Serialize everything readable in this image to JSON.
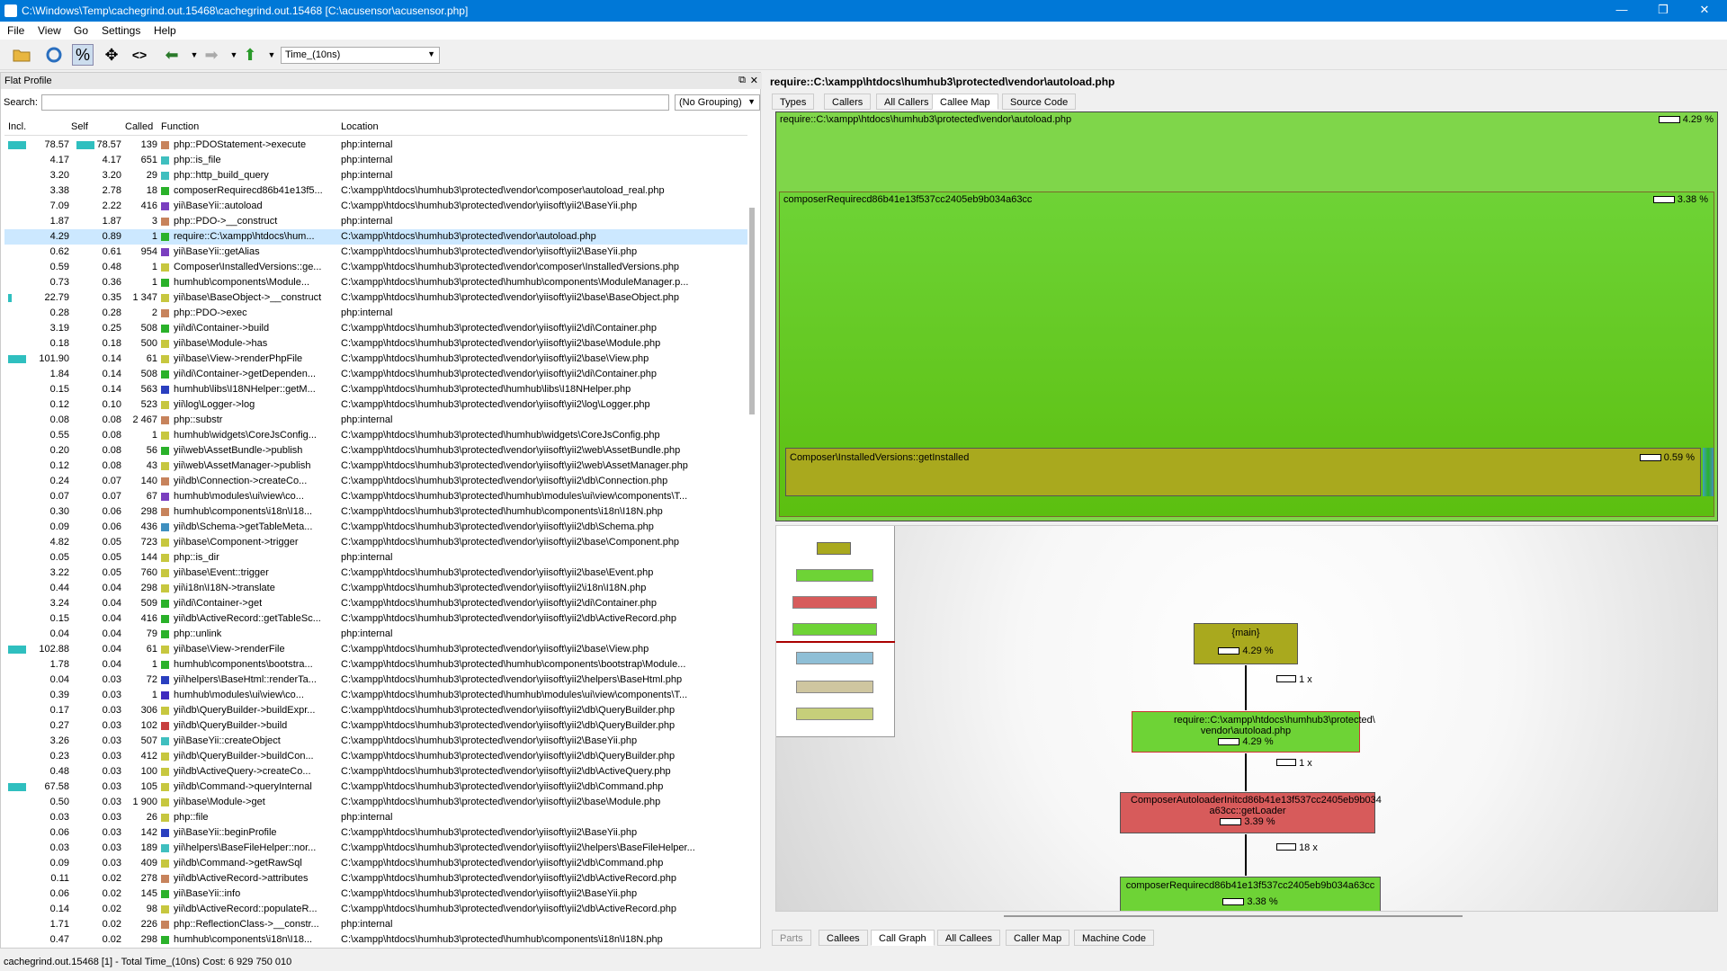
{
  "window": {
    "title": "C:\\Windows\\Temp\\cachegrind.out.15468\\cachegrind.out.15468 [C:\\acusensor\\acusensor.php]",
    "minimize": "—",
    "maximize": "❐",
    "close": "✕"
  },
  "menu": [
    "File",
    "View",
    "Go",
    "Settings",
    "Help"
  ],
  "toolbar": {
    "cost_type": "Time_(10ns)"
  },
  "flat_profile": {
    "title": "Flat Profile",
    "search_label": "Search:",
    "grouping": "(No Grouping)",
    "headers": [
      "Incl.",
      "Self",
      "Called",
      "Function",
      "Location"
    ],
    "rows": [
      [
        "78.57",
        "78.57",
        "139",
        "php::PDOStatement->execute",
        "php:internal",
        "#c7835c",
        1,
        1
      ],
      [
        "4.17",
        "4.17",
        "651",
        "php::is_file",
        "php:internal",
        "#3fbfbf",
        0,
        0
      ],
      [
        "3.20",
        "3.20",
        "29",
        "php::http_build_query",
        "php:internal",
        "#3fbfbf",
        0,
        0
      ],
      [
        "3.38",
        "2.78",
        "18",
        "composerRequirecd86b41e13f5...",
        "C:\\xampp\\htdocs\\humhub3\\protected\\vendor\\composer\\autoload_real.php",
        "#2ab12a",
        0,
        0
      ],
      [
        "7.09",
        "2.22",
        "416",
        "yii\\BaseYii::autoload",
        "C:\\xampp\\htdocs\\humhub3\\protected\\vendor\\yiisoft\\yii2\\BaseYii.php",
        "#7a3fbf",
        0,
        0
      ],
      [
        "1.87",
        "1.87",
        "3",
        "php::PDO->__construct",
        "php:internal",
        "#c7835c",
        0,
        0
      ],
      [
        "4.29",
        "0.89",
        "1",
        "require::C:\\xampp\\htdocs\\hum...",
        "C:\\xampp\\htdocs\\humhub3\\protected\\vendor\\autoload.php",
        "#2ab12a",
        0,
        0
      ],
      [
        "0.62",
        "0.61",
        "954",
        "yii\\BaseYii::getAlias",
        "C:\\xampp\\htdocs\\humhub3\\protected\\vendor\\yiisoft\\yii2\\BaseYii.php",
        "#7a3fbf",
        0,
        0
      ],
      [
        "0.59",
        "0.48",
        "1",
        "Composer\\InstalledVersions::ge...",
        "C:\\xampp\\htdocs\\humhub3\\protected\\vendor\\composer\\InstalledVersions.php",
        "#c7c73f",
        0,
        0
      ],
      [
        "0.73",
        "0.36",
        "1",
        "humhub\\components\\Module...",
        "C:\\xampp\\htdocs\\humhub3\\protected\\humhub\\components\\ModuleManager.p...",
        "#2ab12a",
        0,
        0
      ],
      [
        "22.79",
        "0.35",
        "1 347",
        "yii\\base\\BaseObject->__construct",
        "C:\\xampp\\htdocs\\humhub3\\protected\\vendor\\yiisoft\\yii2\\base\\BaseObject.php",
        "#c7c73f",
        1,
        0
      ],
      [
        "0.28",
        "0.28",
        "2",
        "php::PDO->exec",
        "php:internal",
        "#c7835c",
        0,
        0
      ],
      [
        "3.19",
        "0.25",
        "508",
        "yii\\di\\Container->build",
        "C:\\xampp\\htdocs\\humhub3\\protected\\vendor\\yiisoft\\yii2\\di\\Container.php",
        "#2ab12a",
        0,
        0
      ],
      [
        "0.18",
        "0.18",
        "500",
        "yii\\base\\Module->has",
        "C:\\xampp\\htdocs\\humhub3\\protected\\vendor\\yiisoft\\yii2\\base\\Module.php",
        "#c7c73f",
        0,
        0
      ],
      [
        "101.90",
        "0.14",
        "61",
        "yii\\base\\View->renderPhpFile",
        "C:\\xampp\\htdocs\\humhub3\\protected\\vendor\\yiisoft\\yii2\\base\\View.php",
        "#c7c73f",
        1,
        0
      ],
      [
        "1.84",
        "0.14",
        "508",
        "yii\\di\\Container->getDependen...",
        "C:\\xampp\\htdocs\\humhub3\\protected\\vendor\\yiisoft\\yii2\\di\\Container.php",
        "#2ab12a",
        0,
        0
      ],
      [
        "0.15",
        "0.14",
        "563",
        "humhub\\libs\\I18NHelper::getM...",
        "C:\\xampp\\htdocs\\humhub3\\protected\\humhub\\libs\\I18NHelper.php",
        "#2a3fbf",
        0,
        0
      ],
      [
        "0.12",
        "0.10",
        "523",
        "yii\\log\\Logger->log",
        "C:\\xampp\\htdocs\\humhub3\\protected\\vendor\\yiisoft\\yii2\\log\\Logger.php",
        "#c7c73f",
        0,
        0
      ],
      [
        "0.08",
        "0.08",
        "2 467",
        "php::substr",
        "php:internal",
        "#c7835c",
        0,
        0
      ],
      [
        "0.55",
        "0.08",
        "1",
        "humhub\\widgets\\CoreJsConfig...",
        "C:\\xampp\\htdocs\\humhub3\\protected\\humhub\\widgets\\CoreJsConfig.php",
        "#c7c73f",
        0,
        0
      ],
      [
        "0.20",
        "0.08",
        "56",
        "yii\\web\\AssetBundle->publish",
        "C:\\xampp\\htdocs\\humhub3\\protected\\vendor\\yiisoft\\yii2\\web\\AssetBundle.php",
        "#2ab12a",
        0,
        0
      ],
      [
        "0.12",
        "0.08",
        "43",
        "yii\\web\\AssetManager->publish",
        "C:\\xampp\\htdocs\\humhub3\\protected\\vendor\\yiisoft\\yii2\\web\\AssetManager.php",
        "#c7c73f",
        0,
        0
      ],
      [
        "0.24",
        "0.07",
        "140",
        "yii\\db\\Connection->createCo...",
        "C:\\xampp\\htdocs\\humhub3\\protected\\vendor\\yiisoft\\yii2\\db\\Connection.php",
        "#c7835c",
        0,
        0
      ],
      [
        "0.07",
        "0.07",
        "67",
        "humhub\\modules\\ui\\view\\co...",
        "C:\\xampp\\htdocs\\humhub3\\protected\\humhub\\modules\\ui\\view\\components\\T...",
        "#7a3fbf",
        0,
        0
      ],
      [
        "0.30",
        "0.06",
        "298",
        "humhub\\components\\i18n\\I18...",
        "C:\\xampp\\htdocs\\humhub3\\protected\\humhub\\components\\i18n\\I18N.php",
        "#c7835c",
        0,
        0
      ],
      [
        "0.09",
        "0.06",
        "436",
        "yii\\db\\Schema->getTableMeta...",
        "C:\\xampp\\htdocs\\humhub3\\protected\\vendor\\yiisoft\\yii2\\db\\Schema.php",
        "#3f8fbf",
        0,
        0
      ],
      [
        "4.82",
        "0.05",
        "723",
        "yii\\base\\Component->trigger",
        "C:\\xampp\\htdocs\\humhub3\\protected\\vendor\\yiisoft\\yii2\\base\\Component.php",
        "#c7c73f",
        0,
        0
      ],
      [
        "0.05",
        "0.05",
        "144",
        "php::is_dir",
        "php:internal",
        "#c7c73f",
        0,
        0
      ],
      [
        "3.22",
        "0.05",
        "760",
        "yii\\base\\Event::trigger",
        "C:\\xampp\\htdocs\\humhub3\\protected\\vendor\\yiisoft\\yii2\\base\\Event.php",
        "#c7c73f",
        0,
        0
      ],
      [
        "0.44",
        "0.04",
        "298",
        "yii\\i18n\\I18N->translate",
        "C:\\xampp\\htdocs\\humhub3\\protected\\vendor\\yiisoft\\yii2\\i18n\\I18N.php",
        "#c7c73f",
        0,
        0
      ],
      [
        "3.24",
        "0.04",
        "509",
        "yii\\di\\Container->get",
        "C:\\xampp\\htdocs\\humhub3\\protected\\vendor\\yiisoft\\yii2\\di\\Container.php",
        "#2ab12a",
        0,
        0
      ],
      [
        "0.15",
        "0.04",
        "416",
        "yii\\db\\ActiveRecord::getTableSc...",
        "C:\\xampp\\htdocs\\humhub3\\protected\\vendor\\yiisoft\\yii2\\db\\ActiveRecord.php",
        "#2ab12a",
        0,
        0
      ],
      [
        "0.04",
        "0.04",
        "79",
        "php::unlink",
        "php:internal",
        "#2ab12a",
        0,
        0
      ],
      [
        "102.88",
        "0.04",
        "61",
        "yii\\base\\View->renderFile",
        "C:\\xampp\\htdocs\\humhub3\\protected\\vendor\\yiisoft\\yii2\\base\\View.php",
        "#c7c73f",
        1,
        0
      ],
      [
        "1.78",
        "0.04",
        "1",
        "humhub\\components\\bootstra...",
        "C:\\xampp\\htdocs\\humhub3\\protected\\humhub\\components\\bootstrap\\Module...",
        "#2ab12a",
        0,
        0
      ],
      [
        "0.04",
        "0.03",
        "72",
        "yii\\helpers\\BaseHtml::renderTa...",
        "C:\\xampp\\htdocs\\humhub3\\protected\\vendor\\yiisoft\\yii2\\helpers\\BaseHtml.php",
        "#2a3fbf",
        0,
        0
      ],
      [
        "0.39",
        "0.03",
        "1",
        "humhub\\modules\\ui\\view\\co...",
        "C:\\xampp\\htdocs\\humhub3\\protected\\humhub\\modules\\ui\\view\\components\\T...",
        "#3f2abf",
        0,
        0
      ],
      [
        "0.17",
        "0.03",
        "306",
        "yii\\db\\QueryBuilder->buildExpr...",
        "C:\\xampp\\htdocs\\humhub3\\protected\\vendor\\yiisoft\\yii2\\db\\QueryBuilder.php",
        "#c7c73f",
        0,
        0
      ],
      [
        "0.27",
        "0.03",
        "102",
        "yii\\db\\QueryBuilder->build",
        "C:\\xampp\\htdocs\\humhub3\\protected\\vendor\\yiisoft\\yii2\\db\\QueryBuilder.php",
        "#c73f3f",
        0,
        0
      ],
      [
        "3.26",
        "0.03",
        "507",
        "yii\\BaseYii::createObject",
        "C:\\xampp\\htdocs\\humhub3\\protected\\vendor\\yiisoft\\yii2\\BaseYii.php",
        "#3fbfbf",
        0,
        0
      ],
      [
        "0.23",
        "0.03",
        "412",
        "yii\\db\\QueryBuilder->buildCon...",
        "C:\\xampp\\htdocs\\humhub3\\protected\\vendor\\yiisoft\\yii2\\db\\QueryBuilder.php",
        "#c7c73f",
        0,
        0
      ],
      [
        "0.48",
        "0.03",
        "100",
        "yii\\db\\ActiveQuery->createCo...",
        "C:\\xampp\\htdocs\\humhub3\\protected\\vendor\\yiisoft\\yii2\\db\\ActiveQuery.php",
        "#c7c73f",
        0,
        0
      ],
      [
        "67.58",
        "0.03",
        "105",
        "yii\\db\\Command->queryInternal",
        "C:\\xampp\\htdocs\\humhub3\\protected\\vendor\\yiisoft\\yii2\\db\\Command.php",
        "#c7c73f",
        1,
        0
      ],
      [
        "0.50",
        "0.03",
        "1 900",
        "yii\\base\\Module->get",
        "C:\\xampp\\htdocs\\humhub3\\protected\\vendor\\yiisoft\\yii2\\base\\Module.php",
        "#c7c73f",
        0,
        0
      ],
      [
        "0.03",
        "0.03",
        "26",
        "php::file",
        "php:internal",
        "#c7c73f",
        0,
        0
      ],
      [
        "0.06",
        "0.03",
        "142",
        "yii\\BaseYii::beginProfile",
        "C:\\xampp\\htdocs\\humhub3\\protected\\vendor\\yiisoft\\yii2\\BaseYii.php",
        "#2a3fbf",
        0,
        0
      ],
      [
        "0.03",
        "0.03",
        "189",
        "yii\\helpers\\BaseFileHelper::nor...",
        "C:\\xampp\\htdocs\\humhub3\\protected\\vendor\\yiisoft\\yii2\\helpers\\BaseFileHelper...",
        "#3fbfbf",
        0,
        0
      ],
      [
        "0.09",
        "0.03",
        "409",
        "yii\\db\\Command->getRawSql",
        "C:\\xampp\\htdocs\\humhub3\\protected\\vendor\\yiisoft\\yii2\\db\\Command.php",
        "#c7c73f",
        0,
        0
      ],
      [
        "0.11",
        "0.02",
        "278",
        "yii\\db\\ActiveRecord->attributes",
        "C:\\xampp\\htdocs\\humhub3\\protected\\vendor\\yiisoft\\yii2\\db\\ActiveRecord.php",
        "#c7835c",
        0,
        0
      ],
      [
        "0.06",
        "0.02",
        "145",
        "yii\\BaseYii::info",
        "C:\\xampp\\htdocs\\humhub3\\protected\\vendor\\yiisoft\\yii2\\BaseYii.php",
        "#2ab12a",
        0,
        0
      ],
      [
        "0.14",
        "0.02",
        "98",
        "yii\\db\\ActiveRecord::populateR...",
        "C:\\xampp\\htdocs\\humhub3\\protected\\vendor\\yiisoft\\yii2\\db\\ActiveRecord.php",
        "#c7c73f",
        0,
        0
      ],
      [
        "1.71",
        "0.02",
        "226",
        "php::ReflectionClass->__constr...",
        "php:internal",
        "#c7835c",
        0,
        0
      ],
      [
        "0.47",
        "0.02",
        "298",
        "humhub\\components\\i18n\\I18...",
        "C:\\xampp\\htdocs\\humhub3\\protected\\humhub\\components\\i18n\\I18N.php",
        "#2ab12a",
        0,
        0
      ]
    ]
  },
  "right": {
    "title": "require::C:\\xampp\\htdocs\\humhub3\\protected\\vendor\\autoload.php",
    "top_tabs": [
      "Types",
      "Callers",
      "All Callers",
      "Callee Map",
      "Source Code"
    ],
    "map": {
      "outer_label": "require::C:\\xampp\\htdocs\\humhub3\\protected\\vendor\\autoload.php",
      "outer_pct": "4.29 %",
      "inner_label": "composerRequirecd86b41e13f537cc2405eb9b034a63cc",
      "inner_pct": "3.38 %",
      "small_label": "Composer\\InstalledVersions::getInstalled",
      "small_pct": "0.59 %"
    },
    "graph": {
      "n1_label": "{main}",
      "n1_pct": "4.29 %",
      "e1": "1 x",
      "n2_label": "require::C:\\xampp\\htdocs\\humhub3\\protected\\ vendor\\autoload.php",
      "n2_pct": "4.29 %",
      "e2": "1 x",
      "n3_label": "ComposerAutoloaderInitcd86b41e13f537cc2405eb9b034 a63cc::getLoader",
      "n3_pct": "3.39 %",
      "e3": "18 x",
      "n4_label": "composerRequirecd86b41e13f537cc2405eb9b034a63cc",
      "n4_pct": "3.38 %"
    },
    "bottom_tabs": [
      "Parts",
      "Callees",
      "Call Graph",
      "All Callees",
      "Caller Map",
      "Machine Code"
    ]
  },
  "status": "cachegrind.out.15468 [1] - Total Time_(10ns) Cost: 6 929 750 010"
}
